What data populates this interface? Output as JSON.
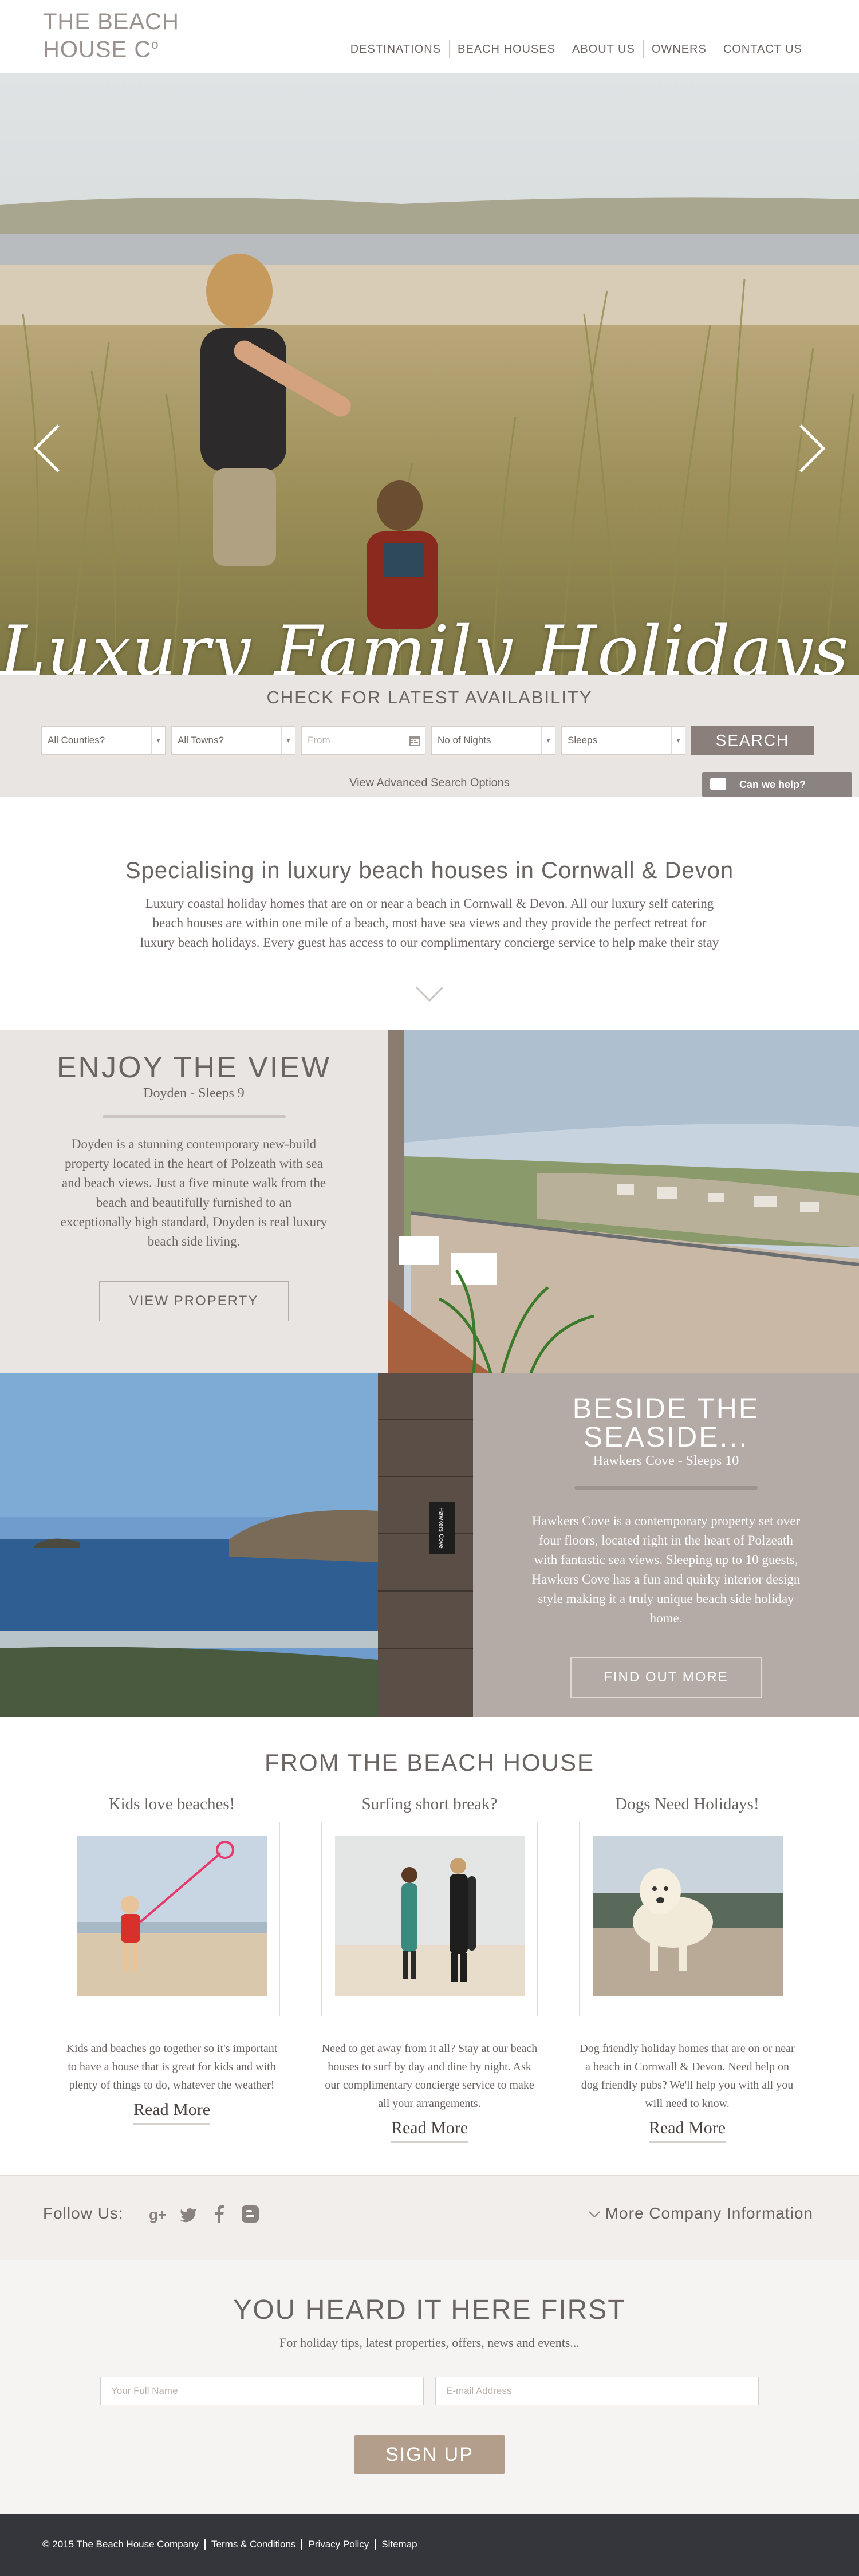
{
  "header": {
    "logo_line1": "THE BEACH",
    "logo_line2": "HOUSE C",
    "logo_sup": "o",
    "nav": [
      "DESTINATIONS",
      "BEACH HOUSES",
      "ABOUT US",
      "OWNERS",
      "CONTACT US"
    ]
  },
  "hero": {
    "caption": "Luxury Family Holidays by the Sea",
    "icons": {
      "prev": "chevron-left-icon",
      "next": "chevron-right-icon"
    }
  },
  "search": {
    "title": "CHECK FOR LATEST AVAILABILITY",
    "county": "All Counties?",
    "town": "All Towns?",
    "from_placeholder": "From",
    "nights": "No of Nights",
    "sleeps": "Sleeps",
    "button": "SEARCH",
    "advanced": "View Advanced Search Options",
    "help": "Can we help?"
  },
  "intro": {
    "title": "Specialising in luxury beach houses in Cornwall & Devon",
    "body": "Luxury coastal holiday homes that are on or near a beach in Cornwall & Devon. All our luxury self catering beach houses are within one mile of a beach, most have sea views and they provide the perfect retreat for luxury beach holidays. Every guest has access to our complimentary concierge service to help make their stay"
  },
  "features": [
    {
      "title": "ENJOY THE VIEW",
      "subtitle": "Doyden - Sleeps 9",
      "body": "Doyden is a stunning contemporary new-build property located in the heart of Polzeath with sea and beach views. Just a five minute walk from the beach and beautifully furnished to an exceptionally high standard, Doyden is real luxury beach side living.",
      "button": "VIEW PROPERTY"
    },
    {
      "title_line1": "BESIDE THE",
      "title_line2": "SEASIDE...",
      "subtitle": "Hawkers Cove - Sleeps 10",
      "body": "Hawkers Cove is a contemporary property set over four floors, located right in the heart of Polzeath with fantastic sea views. Sleeping up to 10 guests, Hawkers Cove has a fun and quirky interior design style making it a truly unique beach side holiday home.",
      "button": "FIND OUT MORE",
      "sign_text": "Hawkers Cove"
    }
  ],
  "blog": {
    "title": "FROM THE BEACH HOUSE",
    "cards": [
      {
        "title": "Kids love beaches!",
        "body": "Kids and beaches go together so it's important to have a house that is great for kids and with plenty of things to do, whatever the weather!",
        "more": "Read More"
      },
      {
        "title": "Surfing short break?",
        "body": "Need to get away from it all? Stay at our beach houses to surf by day and dine by night. Ask our complimentary concierge service to make all your arrangements.",
        "more": "Read More"
      },
      {
        "title": "Dogs Need Holidays!",
        "body": "Dog friendly holiday homes that are on or near a beach in Cornwall & Devon. Need help on dog friendly pubs? We'll help you with all you will need to know.",
        "more": "Read More"
      }
    ]
  },
  "follow": {
    "label": "Follow Us:",
    "social": [
      "google-plus-icon",
      "twitter-icon",
      "facebook-icon",
      "blogger-icon"
    ],
    "more_info": "More Company Information"
  },
  "newsletter": {
    "title": "YOU HEARD IT HERE FIRST",
    "tagline": "For holiday tips, latest properties, offers, news and events...",
    "name_placeholder": "Your Full Name",
    "email_placeholder": "E-mail Address",
    "button": "SIGN UP"
  },
  "footer": {
    "copyright": "© 2015 The Beach House Company",
    "links": [
      "Terms & Conditions",
      "Privacy Policy",
      "Sitemap"
    ]
  },
  "colors": {
    "text": "#6a6462",
    "panel_light": "#e9e5e2",
    "panel_taupe": "#b4aba7",
    "search_button": "#8a7f7b",
    "signup_button": "#b39e8c",
    "footer": "#35363b"
  }
}
